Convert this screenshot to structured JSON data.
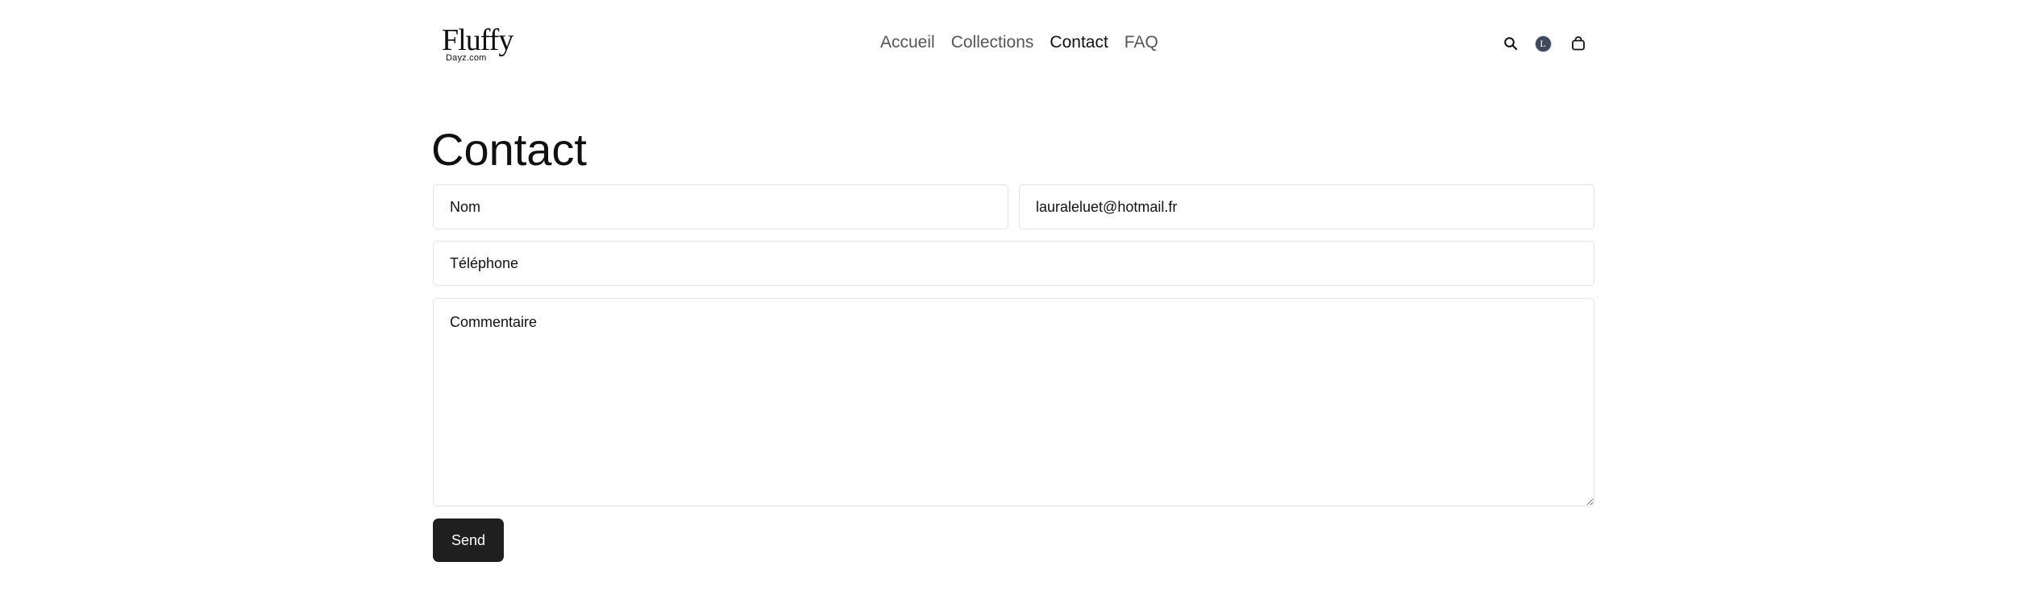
{
  "header": {
    "logo": {
      "main": "Fluffy",
      "sub": "Dayz.com"
    },
    "nav": [
      {
        "label": "Accueil",
        "active": false
      },
      {
        "label": "Collections",
        "active": false
      },
      {
        "label": "Contact",
        "active": true
      },
      {
        "label": "FAQ",
        "active": false
      }
    ],
    "icons": {
      "search": "search-icon",
      "account": "account-icon",
      "account_initial": "L",
      "cart": "shopping-bag-icon"
    }
  },
  "main": {
    "title": "Contact",
    "form": {
      "name_placeholder": "Nom",
      "email_value": "lauraleluet@hotmail.fr",
      "phone_placeholder": "Téléphone",
      "comment_placeholder": "Commentaire",
      "send_label": "Send"
    }
  },
  "colors": {
    "text": "#111111",
    "nav_inactive": "#555555",
    "border": "#e3e3e3",
    "button_bg": "#1f1f1f",
    "avatar_bg": "#3d4a5c"
  }
}
